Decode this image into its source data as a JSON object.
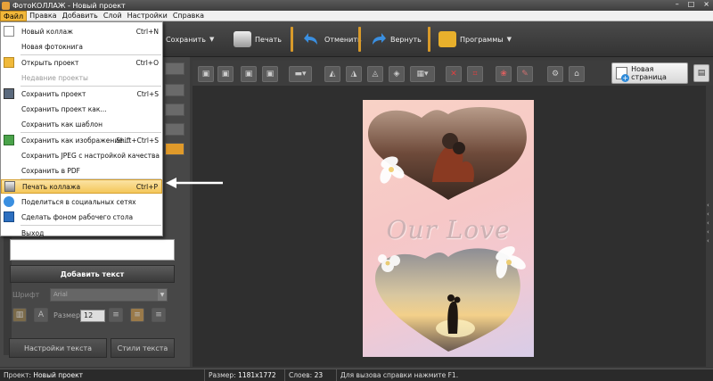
{
  "window": {
    "title": "ФотоКОЛЛАЖ - Новый проект",
    "controls": [
      "–",
      "□",
      "×"
    ]
  },
  "menubar": {
    "items": [
      "Файл",
      "Правка",
      "Добавить",
      "Слой",
      "Настройки",
      "Справка"
    ]
  },
  "toolbar": {
    "save": "Сохранить",
    "print": "Печать",
    "undo": "Отменить",
    "redo": "Вернуть",
    "programs": "Программы"
  },
  "toolbar2": {
    "new_page": "Новая страница"
  },
  "file_menu": {
    "items": [
      {
        "label": "Новый коллаж",
        "shortcut": "Ctrl+N",
        "disabled": false
      },
      {
        "label": "Новая фотокнига",
        "shortcut": "",
        "disabled": false
      },
      {
        "label": "Открыть проект",
        "shortcut": "Ctrl+O",
        "disabled": false
      },
      {
        "label": "Недавние проекты",
        "shortcut": "",
        "disabled": true
      },
      {
        "label": "Сохранить проект",
        "shortcut": "Ctrl+S",
        "disabled": false
      },
      {
        "label": "Сохранить проект как...",
        "shortcut": "",
        "disabled": false
      },
      {
        "label": "Сохранить как шаблон",
        "shortcut": "",
        "disabled": false
      },
      {
        "label": "Сохранить как изображение...",
        "shortcut": "Shift+Ctrl+S",
        "disabled": false
      },
      {
        "label": "Сохранить JPEG с настройкой качества",
        "shortcut": "",
        "disabled": false
      },
      {
        "label": "Сохранить в PDF",
        "shortcut": "",
        "disabled": false
      },
      {
        "label": "Печать коллажа",
        "shortcut": "Ctrl+P",
        "highlighted": true
      },
      {
        "label": "Поделиться в социальных сетях",
        "shortcut": "",
        "disabled": false
      },
      {
        "label": "Сделать фоном рабочего стола",
        "shortcut": "",
        "disabled": false
      },
      {
        "label": "Выход",
        "shortcut": "",
        "disabled": false
      }
    ]
  },
  "leftpanel": {
    "add_text": "Добавить текст",
    "font_label": "Шрифт",
    "font_value": "Arial",
    "size_label": "Размер",
    "size_value": "12",
    "text_settings": "Настройки текста",
    "text_styles": "Стили текста"
  },
  "collage": {
    "text": "Our Love"
  },
  "statusbar": {
    "project_label": "Проект:",
    "project_value": "Новый проект",
    "size_label": "Размер:",
    "size_value": "1181x1772",
    "layers_label": "Слоев:",
    "layers_value": "23",
    "help": "Для вызова справки нажмите F1."
  },
  "colors": {
    "accent": "#f2b83a",
    "toolbar": "#3d3d3d",
    "panel": "#474747"
  }
}
